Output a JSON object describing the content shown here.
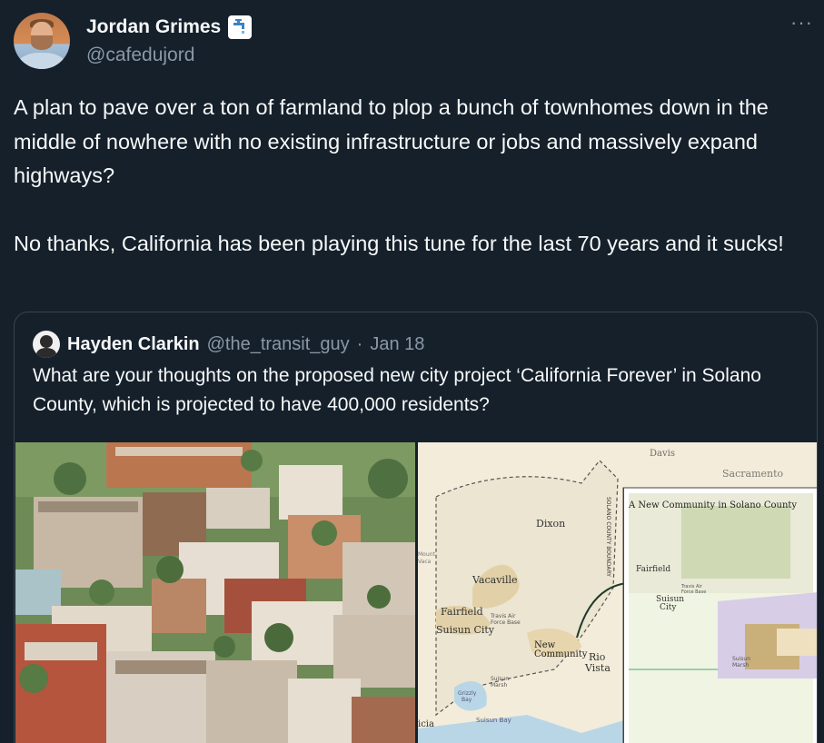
{
  "tweet": {
    "author_name": "Jordan Grimes",
    "author_handle": "@cafedujord",
    "more_label": "···",
    "text": "A plan to pave over a ton of farmland to plop a bunch of townhomes down in the middle of nowhere with no existing infrastructure or jobs and massively expand highways?\n\nNo thanks, California has been playing this tune for the last 70 years and it sucks!"
  },
  "quoted": {
    "author_name": "Hayden Clarkin",
    "author_handle": "@the_transit_guy",
    "separator": "·",
    "date": "Jan 18",
    "text": "What are your thoughts on the proposed new city project ‘California Forever’ in Solano County, which is projected to have 400,000 residents?"
  },
  "map": {
    "davis": "Davis",
    "sacramento": "Sacramento",
    "dixon": "Dixon",
    "vacaville": "Vacaville",
    "fairfield": "Fairfield",
    "suisun_city": "Suisun City",
    "new_community": "New Community",
    "rio_vista": "Rio Vista",
    "travis": "Travis Air Force Base",
    "suisun_marsh": "Suisun Marsh",
    "grizzly_bay": "Grizzly Bay",
    "suisun_bay": "Suisun Bay",
    "county_boundary": "SOLANO COUNTY BOUNDARY",
    "inset_title": "A New Community in Solano County",
    "inset_fairfield": "Fairfield",
    "inset_suisun": "Suisun City",
    "inset_marsh": "Suisun Marsh",
    "inset_travis": "Travis Air Force Base",
    "mount_vaca": "Mount Vaca",
    "benicia": "icia",
    "route_505": "505",
    "route_80": "80",
    "route_113": "113",
    "route_12": "12",
    "route_680": "680"
  },
  "colors": {
    "background": "#15202b",
    "text": "#f7f9f9",
    "secondary": "#8b98a5",
    "border": "#38444d"
  }
}
